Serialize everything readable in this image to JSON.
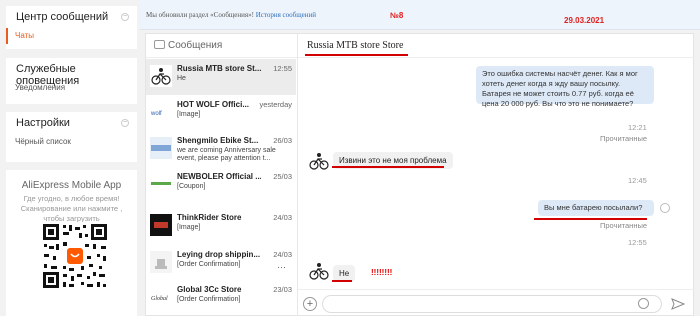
{
  "sidebar": {
    "section1": {
      "title": "Центр сообщений",
      "items": [
        "Чаты"
      ]
    },
    "section2": {
      "title": "Служебные оповещения",
      "items": [
        "Уведомления"
      ]
    },
    "section3": {
      "title": "Настройки",
      "items": [
        "Чёрный список"
      ]
    },
    "app": {
      "title": "AliExpress Mobile App",
      "desc1": "Где угодно, в любое время!",
      "desc2": "Сканирование или нажмите ,",
      "desc3": "чтобы загрузить"
    }
  },
  "topbar": {
    "notice": "Мы обновили раздел «Сообщения»!",
    "link": "История сообщений",
    "tag_num": "№8",
    "tag_date": "29.03.2021"
  },
  "conversations": {
    "header": "Сообщения",
    "items": [
      {
        "name": "Russia MTB store St...",
        "time": "12:55",
        "preview": "Не"
      },
      {
        "name": "HOT WOLF Offici...",
        "time": "yesterday",
        "preview": "[Image]"
      },
      {
        "name": "Shengmilo Ebike St...",
        "time": "26/03",
        "preview": "we are coming Anniversary sale event, please pay attention t..."
      },
      {
        "name": "NEWBOLER Official ...",
        "time": "25/03",
        "preview": "[Coupon]"
      },
      {
        "name": "ThinkRider Store",
        "time": "24/03",
        "preview": "[Image]"
      },
      {
        "name": "Leying drop shippin...",
        "time": "24/03",
        "preview": "[Order Confirmation]"
      },
      {
        "name": "Global 3Cc Store",
        "time": "23/03",
        "preview": "[Order Confirmation]"
      }
    ]
  },
  "chat": {
    "title": "Russia MTB store Store",
    "msg1": "Это ошибка системы насчёт денег. Как я мог хотеть денег когда я жду вашу посылку. Батарея не может стоить 0.77 руб. когда её цена 20 000 руб. Вы что это не понимаете?",
    "status1": "Прочитанные",
    "time1": "12:21",
    "msg2": "Извини это не моя проблема",
    "time2": "12:45",
    "msg3": "Вы мне батарею посылали?",
    "status3": "Прочитанные",
    "time3": "12:55",
    "msg4": "Не",
    "msg4_note": "!!!!!!!!"
  },
  "colors": {
    "accent": "#e85c1c",
    "annotation": "#d20000",
    "bubble_out": "#dde9f7"
  },
  "icons": [
    "chat-bubble-icon",
    "plus-icon",
    "smile-icon",
    "send-icon",
    "collapse-icon"
  ]
}
